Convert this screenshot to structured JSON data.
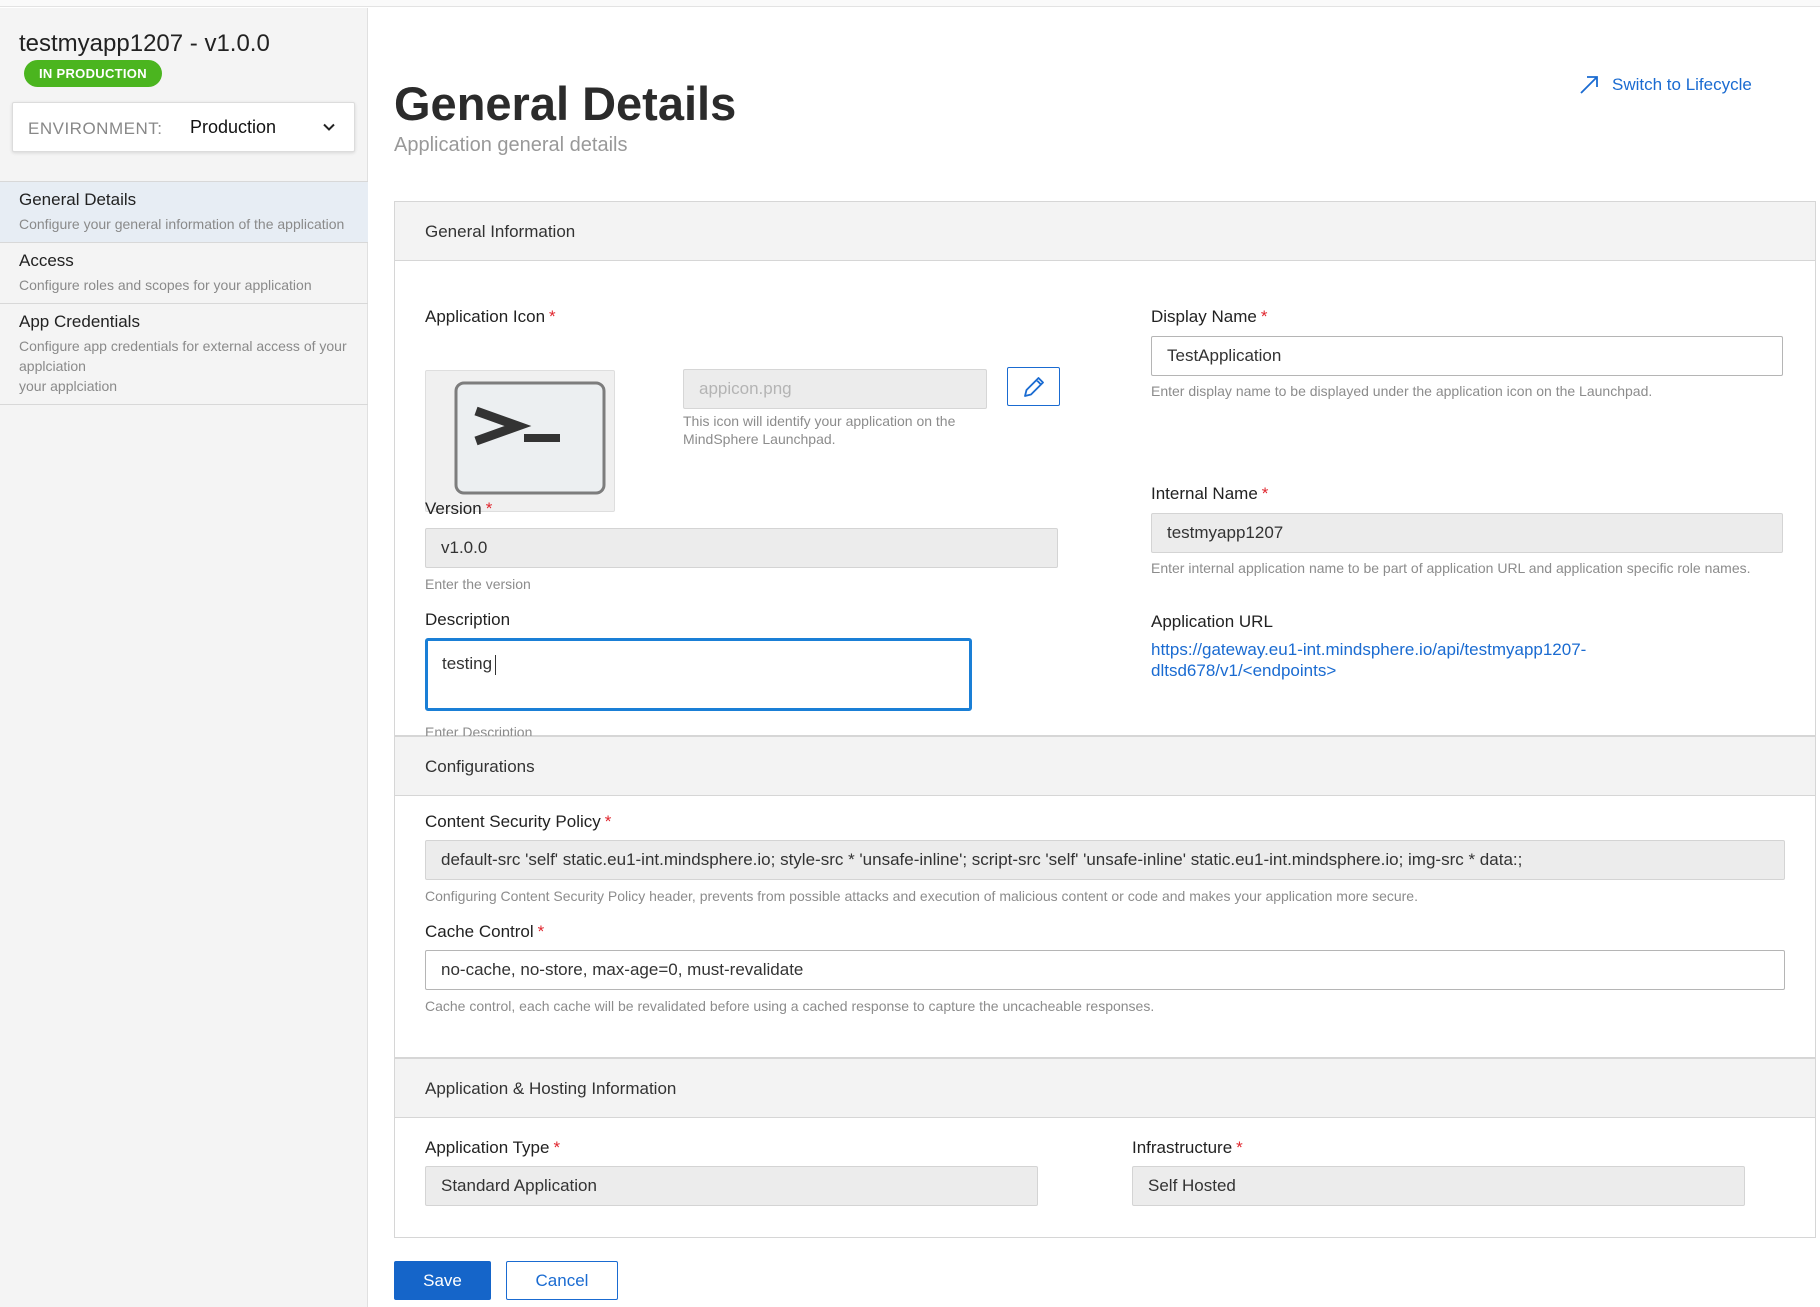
{
  "app": {
    "title": "testmyapp1207 - v1.0.0",
    "status": "IN PRODUCTION",
    "environment_label": "ENVIRONMENT:",
    "environment_value": "Production"
  },
  "nav": {
    "items": [
      {
        "title": "General Details",
        "desc": "Configure your general information of the application",
        "active": true
      },
      {
        "title": "Access",
        "desc": "Configure roles and scopes for your application",
        "active": false
      },
      {
        "title": "App Credentials",
        "desc": "Configure app credentials for external access of your applciation\nyour applciation",
        "active": false
      }
    ]
  },
  "header": {
    "title": "General Details",
    "subtitle": "Application general details",
    "lifecycle_link": "Switch to Lifecycle"
  },
  "general": {
    "heading": "General Information",
    "icon_label": "Application Icon",
    "icon_file_placeholder": "appicon.png",
    "icon_hint": "This icon will identify your application on the MindSphere Launchpad.",
    "version_label": "Version",
    "version_value": "v1.0.0",
    "version_hint": "Enter the version",
    "description_label": "Description",
    "description_value": "testing",
    "description_hint": "Enter Description",
    "display_name_label": "Display Name",
    "display_name_value": "TestApplication",
    "display_name_hint": "Enter display name to be displayed under the application icon on the Launchpad.",
    "internal_name_label": "Internal Name",
    "internal_name_value": "testmyapp1207",
    "internal_name_hint": "Enter internal application name to be part of application URL and application specific role names.",
    "url_label": "Application URL",
    "url_line1": "https://gateway.eu1-int.mindsphere.io/api/testmyapp1207-",
    "url_line2": "dltsd678/v1/<endpoints>"
  },
  "config": {
    "heading": "Configurations",
    "csp_label": "Content Security Policy",
    "csp_value": "default-src 'self' static.eu1-int.mindsphere.io; style-src * 'unsafe-inline'; script-src 'self' 'unsafe-inline' static.eu1-int.mindsphere.io; img-src * data:;",
    "csp_hint": "Configuring Content Security Policy header, prevents from possible attacks and execution of malicious content or code and makes your application more secure.",
    "cache_label": "Cache Control",
    "cache_value": "no-cache, no-store, max-age=0, must-revalidate",
    "cache_hint": "Cache control, each cache will be revalidated before using a cached response to capture the uncacheable responses."
  },
  "hosting": {
    "heading": "Application & Hosting Information",
    "type_label": "Application Type",
    "type_value": "Standard Application",
    "infra_label": "Infrastructure",
    "infra_value": "Self Hosted"
  },
  "actions": {
    "save": "Save",
    "cancel": "Cancel"
  },
  "required_marker": "*",
  "colors": {
    "accent": "#1a6bd1",
    "primary_button": "#1565c9",
    "status_green": "#4bb51f",
    "required_red": "#e0262e",
    "active_nav_bg": "#e7edf4"
  },
  "icons": [
    "chevron-down-icon",
    "arrow-up-right-icon",
    "pencil-icon",
    "terminal-prompt-icon"
  ]
}
